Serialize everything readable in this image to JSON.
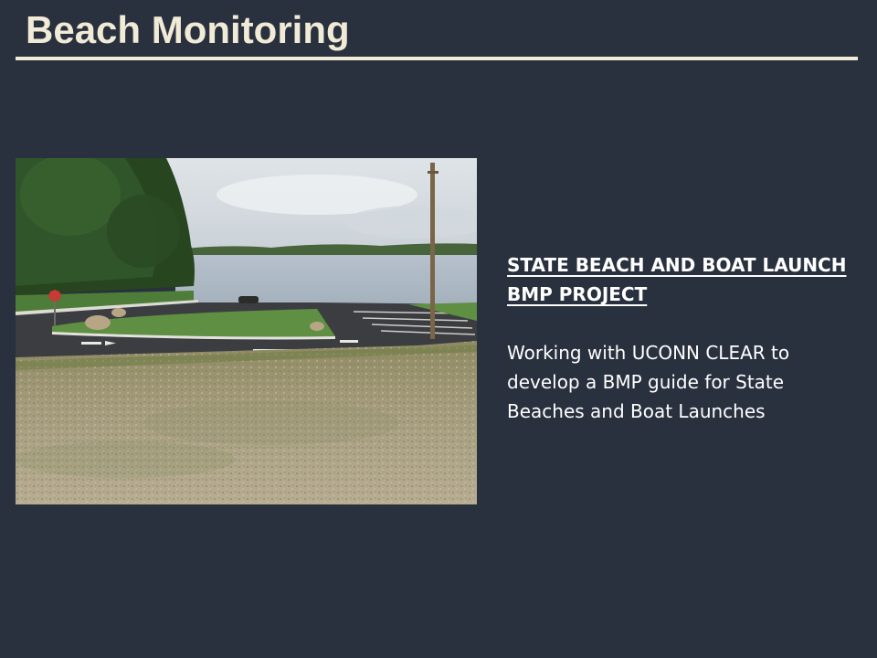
{
  "slide": {
    "title": "Beach Monitoring",
    "heading_lines": [
      "STATE BEACH AND BOAT LAUNCH",
      "BMP PROJECT"
    ],
    "body_lines": [
      "Working with UCONN CLEAR to",
      "develop a BMP guide for State",
      "Beaches and Boat Launches"
    ]
  },
  "colors": {
    "background": "#29313f",
    "title_text": "#f1ead6",
    "rule": "#f1ead6",
    "body_text": "#ffffff"
  }
}
